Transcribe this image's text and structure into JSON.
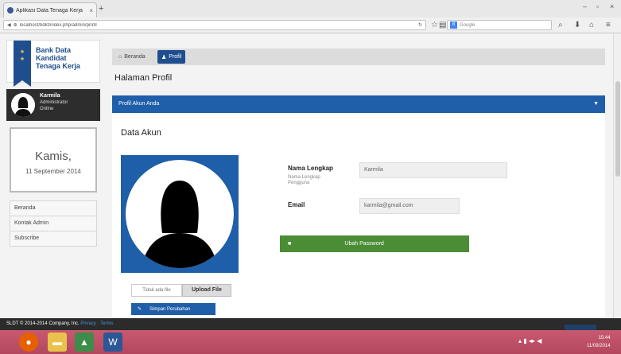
{
  "browser": {
    "tab_title": "Aplikasi Data Tenaga Kerja",
    "tab_close": "×",
    "new_tab": "+",
    "url": "localhost/bdkt/index.php/admin/profil",
    "search_placeholder": "Google",
    "window_controls": [
      "–",
      "▫",
      "×"
    ]
  },
  "sidebar": {
    "brand_lines": [
      "Bank Data",
      "Kandidat",
      "Tenaga Kerja"
    ],
    "user": {
      "name": "Karmila",
      "role": "Administrator",
      "status": "Online"
    },
    "day": "Kamis,",
    "date": "11 September 2014",
    "menu": [
      "Beranda",
      "Kontak Admin",
      "Subscribe"
    ]
  },
  "main": {
    "tabs": [
      {
        "label": "Beranda",
        "icon": "home-icon"
      },
      {
        "label": "Profil",
        "icon": "user-icon"
      }
    ],
    "page_title": "Halaman Profil",
    "panel_title": "Profil Akun Anda",
    "section_title": "Data Akun",
    "name_label": "Nama Lengkap",
    "name_sub": "Nama Lengkap Pengguna",
    "name_value": "Karmila",
    "email_label": "Email",
    "email_value": "karmila@gmail.com",
    "edit_button": "Ubah Password",
    "file_name": "Tidak ada file",
    "upload_button": "Upload File",
    "change_photo_button": "Simpan Perubahan"
  },
  "footer": {
    "copyright": "SLDT © 2014-2014 Company, Inc.",
    "link1": "Privacy",
    "separator": "·",
    "link2": "Terms"
  },
  "taskbar": {
    "apps": [
      "firefox-icon",
      "folder-icon",
      "image-icon",
      "word-icon"
    ],
    "time": "15:44",
    "date": "11/09/2014"
  },
  "colors": {
    "primary": "#1f5ea8",
    "success": "#4a8d35",
    "dark": "#2d2d2d",
    "taskbar": "#b84d64"
  }
}
